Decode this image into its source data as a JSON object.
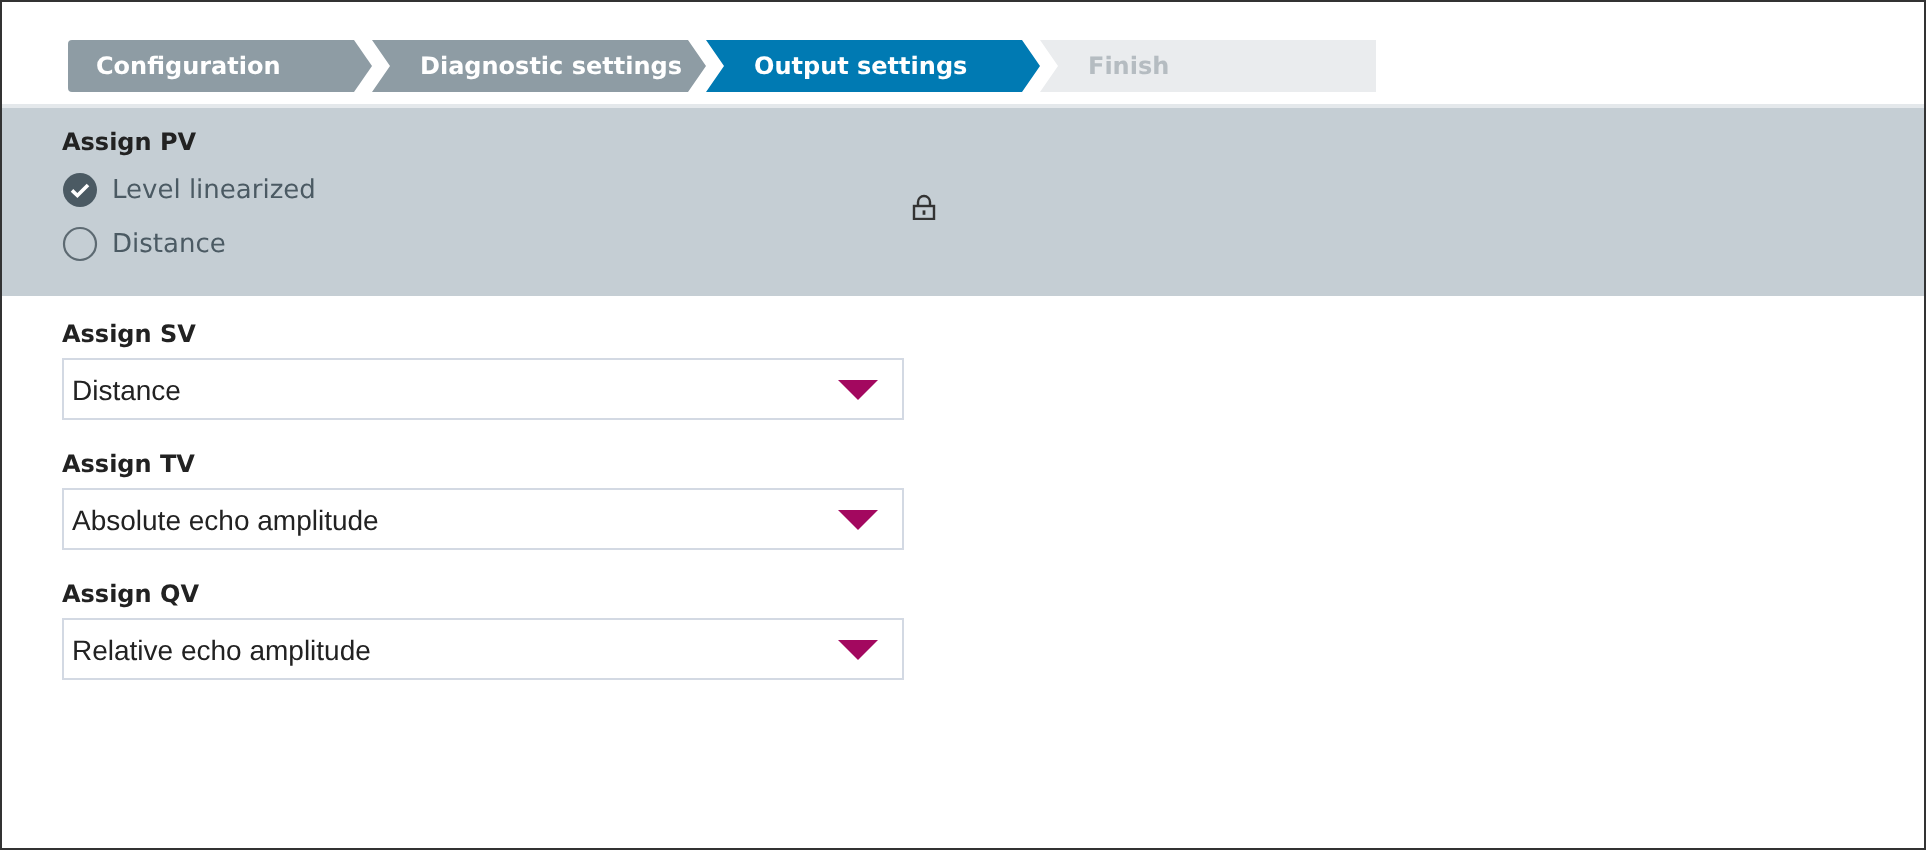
{
  "steps": [
    {
      "label": "Configuration",
      "completed": true,
      "selected": false
    },
    {
      "label": "Diagnostic settings",
      "completed": true,
      "selected": false
    },
    {
      "label": "Output settings",
      "completed": false,
      "selected": true
    },
    {
      "label": "Finish",
      "completed": false,
      "selected": false
    }
  ],
  "assign_pv": {
    "label": "Assign PV",
    "disabled": true,
    "options": [
      {
        "label": "Level linearized",
        "selected": true
      },
      {
        "label": "Distance",
        "selected": false
      }
    ]
  },
  "selects": [
    {
      "label": "Assign SV",
      "value": "Distance"
    },
    {
      "label": "Assign TV",
      "value": "Absolute echo amplitude"
    },
    {
      "label": "Assign QV",
      "value": "Relative echo amplitude"
    }
  ]
}
